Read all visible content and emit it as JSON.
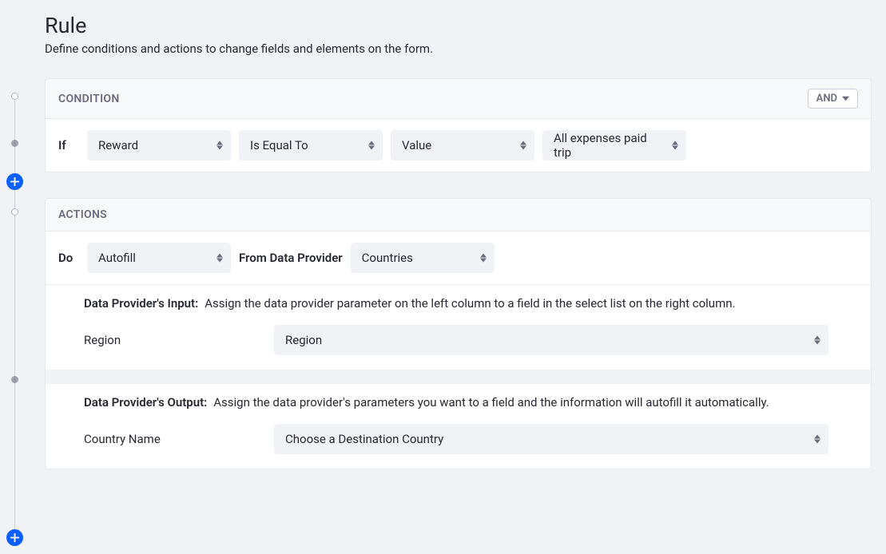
{
  "header": {
    "title": "Rule",
    "subtitle": "Define conditions and actions to change fields and elements on the form."
  },
  "condition": {
    "title": "CONDITION",
    "combinator_label": "AND",
    "if_label": "If",
    "field_select": "Reward",
    "operator_select": "Is Equal To",
    "comparison_type": "Value",
    "value_select": "All expenses paid trip"
  },
  "actions": {
    "title": "ACTIONS",
    "do_label": "Do",
    "action_select": "Autofill",
    "from_dp_label": "From Data Provider",
    "dp_select": "Countries",
    "dp_input": {
      "title": "Data Provider's Input:",
      "description": "Assign the data provider parameter on the left column to a field in the select list on the right column.",
      "param_label": "Region",
      "field_select": "Region"
    },
    "dp_output": {
      "title": "Data Provider's Output:",
      "description": "Assign the data provider's parameters you want to a field and the information will autofill it automatically.",
      "param_label": "Country Name",
      "field_select": "Choose a Destination Country"
    }
  }
}
